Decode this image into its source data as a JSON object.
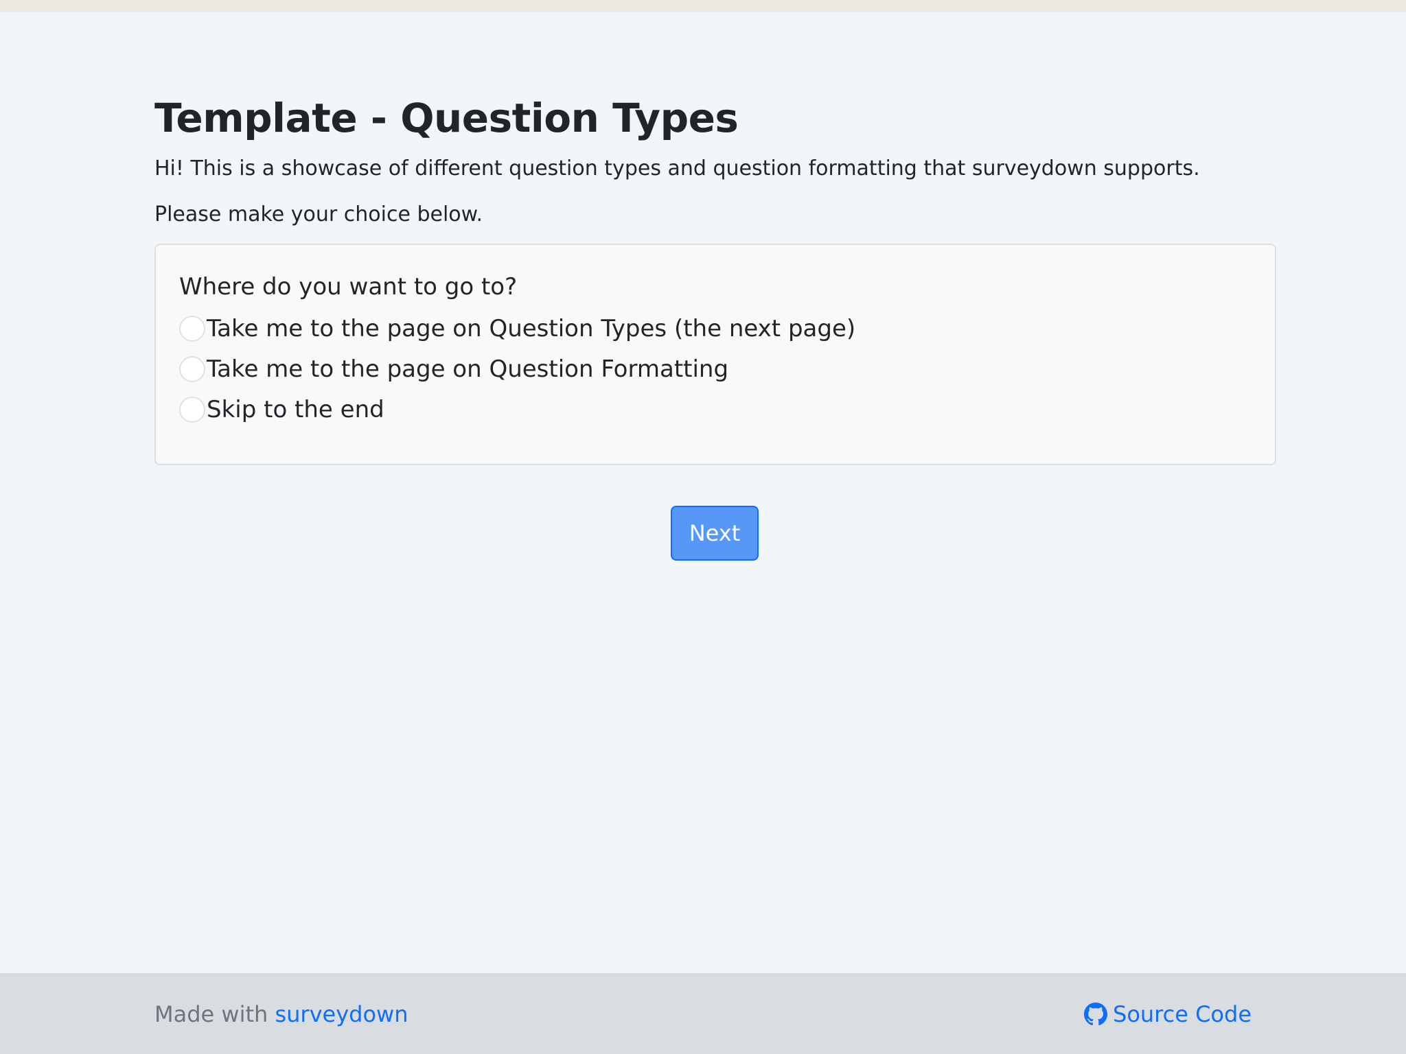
{
  "page": {
    "title": "Template - Question Types",
    "intro": "Hi! This is a showcase of different question types and question formatting that surveydown supports.",
    "instruction": "Please make your choice below."
  },
  "question": {
    "label": "Where do you want to go to?",
    "options": [
      {
        "label": "Take me to the page on Question Types (the next page)",
        "selected": false
      },
      {
        "label": "Take me to the page on Question Formatting",
        "selected": false
      },
      {
        "label": "Skip to the end",
        "selected": false
      }
    ]
  },
  "next_button": {
    "label": "Next"
  },
  "footer": {
    "made_with": "Made with",
    "brand_link": "surveydown",
    "source_link": "Source Code",
    "source_icon": "github-icon"
  },
  "colors": {
    "accent": "#0d6efd",
    "button_fill": "#5797f5",
    "background": "#f3f6f9",
    "footer_bg": "#d9dce0"
  }
}
